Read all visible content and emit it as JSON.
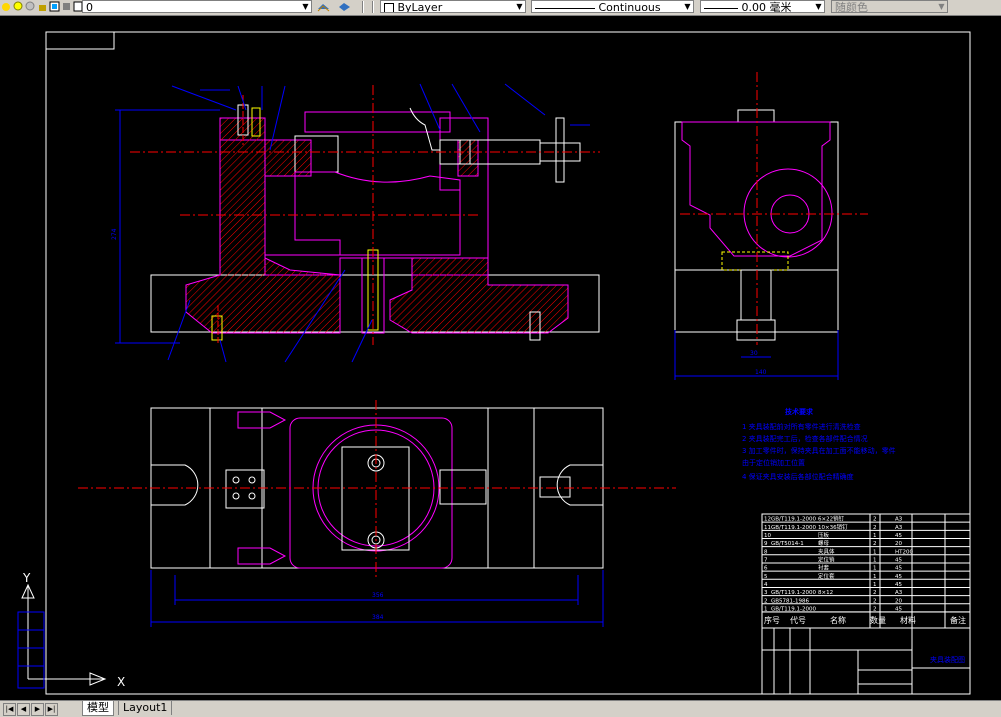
{
  "toolbar": {
    "layer_value": "0",
    "color_value": "ByLayer",
    "linetype_value": "Continuous",
    "lineweight_value": "0.00",
    "lineweight_unit": "毫米",
    "plotstyle_value": "随颜色"
  },
  "tabs": {
    "model": "模型",
    "layout1": "Layout1"
  },
  "colors": {
    "canvas": "#000000",
    "hatch": "#ff0000",
    "outline_magenta": "#ff00ff",
    "dimension_blue": "#0000ff",
    "centerline_red": "#ff0000",
    "outline_white": "#ffffff",
    "accent_yellow": "#ffff00"
  },
  "drawing": {
    "dims": {
      "front_height": "274",
      "view_w1": "140",
      "view_w2": "30",
      "plan_w1": "356",
      "plan_w2": "384"
    },
    "tech_req": {
      "title": "技术要求",
      "items": [
        "1  夹具装配前对所有零件进行清洗检查",
        "2  夹具装配完工后，检查各部件配合情况",
        "3  加工零件时，保持夹具在加工面不能移动，零件",
        "   由于定位销加工位置",
        "4  保证夹具安装后各部位配合精确度"
      ]
    },
    "bom": {
      "rows": [
        {
          "no": "12",
          "code": "GB/T119.1-2000",
          "name": "6×22销钉",
          "qty": "2",
          "mat": "A3"
        },
        {
          "no": "11",
          "code": "GB/T119.1-2000",
          "name": "10×36销钉",
          "qty": "2",
          "mat": "A3"
        },
        {
          "no": "10",
          "code": "",
          "name": "压板",
          "qty": "1",
          "mat": "45"
        },
        {
          "no": "9",
          "code": "GB/T5014-1",
          "name": "螺母",
          "qty": "2",
          "mat": "20"
        },
        {
          "no": "8",
          "code": "",
          "name": "夹具体",
          "qty": "1",
          "mat": "HT200"
        },
        {
          "no": "7",
          "code": "",
          "name": "定位销",
          "qty": "1",
          "mat": "45"
        },
        {
          "no": "6",
          "code": "",
          "name": "衬套",
          "qty": "1",
          "mat": "45"
        },
        {
          "no": "5",
          "code": "",
          "name": "定位套",
          "qty": "1",
          "mat": "45"
        },
        {
          "no": "4",
          "code": "",
          "name": "",
          "qty": "1",
          "mat": "45"
        },
        {
          "no": "3",
          "code": "GB/T119.1-2000",
          "name": "8×12",
          "qty": "2",
          "mat": "A3"
        },
        {
          "no": "2",
          "code": "GB5781-1986",
          "name": "",
          "qty": "2",
          "mat": "20"
        },
        {
          "no": "1",
          "code": "GB/T119.1-2000",
          "name": "",
          "qty": "2",
          "mat": "45"
        }
      ],
      "header": [
        "序号",
        "代号",
        "名称",
        "数量",
        "材料",
        "备注"
      ],
      "drawing_title": "夹具装配图"
    },
    "axis": {
      "y": "Y",
      "x": "X"
    }
  }
}
